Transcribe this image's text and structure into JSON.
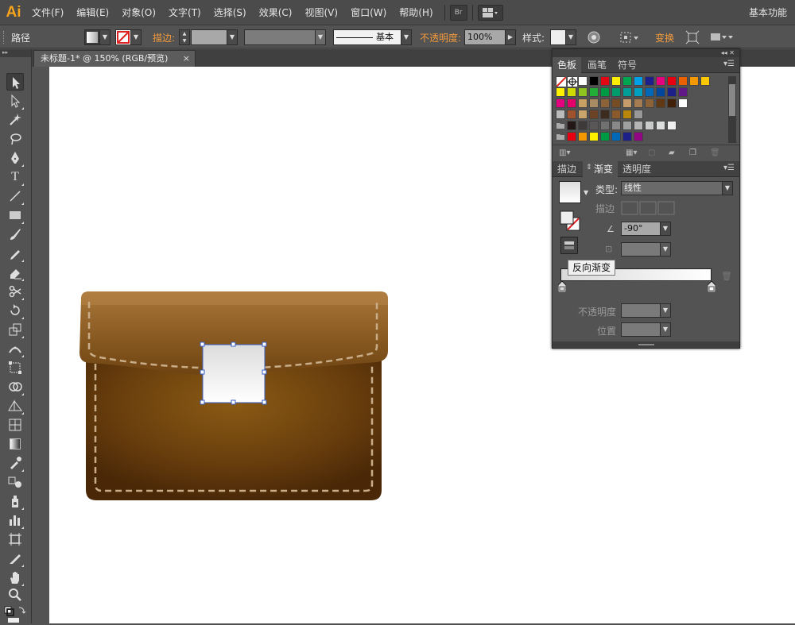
{
  "menubar": {
    "logo": "Ai",
    "items": [
      "文件(F)",
      "编辑(E)",
      "对象(O)",
      "文字(T)",
      "选择(S)",
      "效果(C)",
      "视图(V)",
      "窗口(W)",
      "帮助(H)"
    ],
    "bridge_label": "Br",
    "workspace": "基本功能"
  },
  "controlbar": {
    "object_type": "路径",
    "stroke_label": "描边:",
    "brush_label": "基本",
    "opacity_label": "不透明度:",
    "opacity_value": "100%",
    "style_label": "样式:",
    "transform_label": "变换"
  },
  "document": {
    "tab_title": "未标题-1* @ 150% (RGB/预览)",
    "close": "×"
  },
  "swatches_panel": {
    "tabs": [
      "色板",
      "画笔",
      "符号"
    ],
    "colors": [
      [
        "#ffffff",
        "#000000",
        "#e30613",
        "#ffed00",
        "#00a650",
        "#00a0e9",
        "#1d2088",
        "#e4007f",
        "#e60012",
        "#eb6100",
        "#f39800",
        "#fcc800"
      ],
      [
        "#fff100",
        "#cfdb00",
        "#8fc31f",
        "#22ac38",
        "#009944",
        "#009b6b",
        "#009e96",
        "#00a0c1",
        "#0068b7",
        "#00479d",
        "#1d2088",
        "#601986"
      ],
      [
        "#e4007f",
        "#e5006a",
        "#c9a063",
        "#a88d64",
        "#8c6239",
        "#754c24",
        "#c69c6d",
        "#a67c52",
        "#8c6239",
        "#603813",
        "#42210b",
        "#ffffff"
      ],
      [
        "#a0522d",
        "#c7a56b",
        "#6b4226",
        "#3d2b1f",
        "#8b5a2b",
        "#b8860b",
        "#999999"
      ],
      [
        "#231815",
        "#3e3a39",
        "#595757",
        "#727171",
        "#898989",
        "#9fa0a0",
        "#b5b5b6",
        "#c9caca",
        "#dcdddd",
        "#efefef"
      ],
      [
        "#e60012",
        "#f39800",
        "#fff100",
        "#009944",
        "#0068b7",
        "#1d2088",
        "#920783"
      ]
    ]
  },
  "gradient_panel": {
    "tabs": [
      "描边",
      "渐变",
      "透明度"
    ],
    "type_label": "类型:",
    "type_value": "线性",
    "stroke_label": "描边",
    "angle_value": "-90°",
    "tooltip": "反向渐变",
    "opacity_label": "不透明度",
    "position_label": "位置"
  },
  "colors": {
    "accent": "#f29b3c",
    "bag_dark": "#4a2a07",
    "bag_mid": "#7a4a14",
    "bag_light": "#9c6b2d",
    "selection": "#3a5fc8"
  }
}
